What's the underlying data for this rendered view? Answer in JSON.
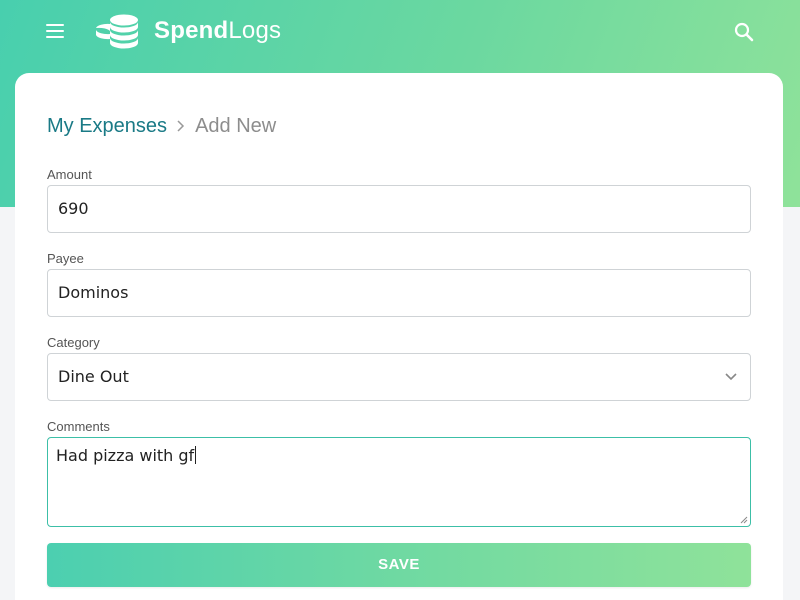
{
  "app": {
    "brand_bold": "Spend",
    "brand_light": "Logs"
  },
  "header": {
    "menu_icon": "hamburger-menu-icon",
    "logo_icon": "coin-stack-icon",
    "search_icon": "search-icon"
  },
  "breadcrumb": {
    "parent": "My Expenses",
    "separator_icon": "chevron-right-icon",
    "current": "Add New"
  },
  "form": {
    "amount": {
      "label": "Amount",
      "value": "690"
    },
    "payee": {
      "label": "Payee",
      "value": "Dominos"
    },
    "category": {
      "label": "Category",
      "value": "Dine Out",
      "arrow_icon": "chevron-down-icon"
    },
    "comments": {
      "label": "Comments",
      "value": "Had pizza with gf"
    },
    "save_label": "SAVE"
  },
  "colors": {
    "gradient_start": "#48cfae",
    "gradient_end": "#8fe29a",
    "link": "#1a7a86",
    "focus_border": "#3cbfa7"
  }
}
